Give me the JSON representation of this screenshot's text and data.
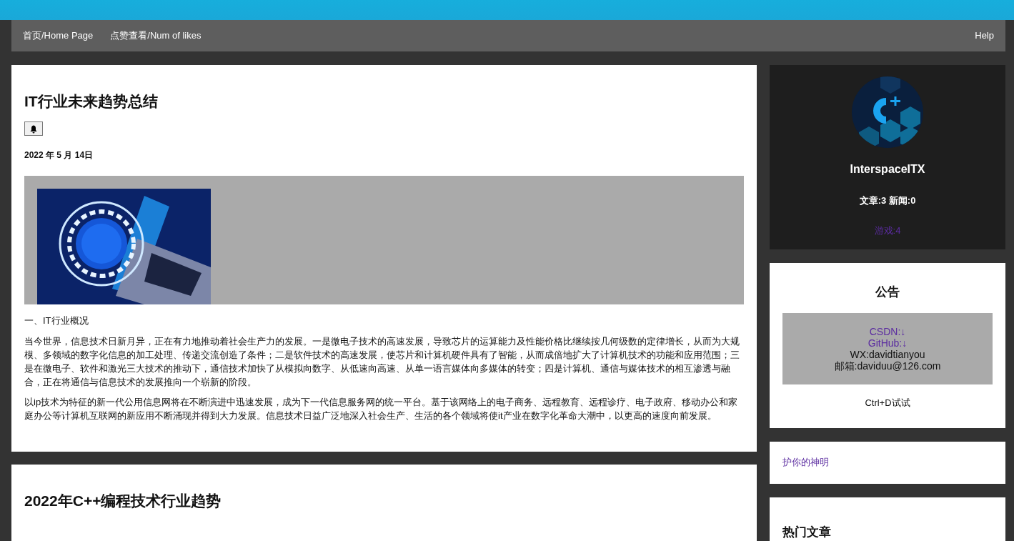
{
  "nav": {
    "items": [
      {
        "label": "首页/Home Page"
      },
      {
        "label": "点赞查看/Num of likes"
      }
    ],
    "help": "Help"
  },
  "articles": [
    {
      "title": "IT行业未来趋势总结",
      "bell": true,
      "date": "2022 年 5 月 14日",
      "image": {
        "kind": "picture"
      },
      "paragraphs": [
        "一、IT行业概况",
        "当今世界，信息技术日新月异，正在有力地推动着社会生产力的发展。一是微电子技术的高速发展，导致芯片的运算能力及性能价格比继续按几何级数的定律增长，从而为大规模、多领域的数字化信息的加工处理、传递交流创造了条件；二是软件技术的高速发展，使芯片和计算机硬件具有了智能，从而成倍地扩大了计算机技术的功能和应用范围；三是在微电子、软件和激光三大技术的推动下，通信技术加快了从模拟向数字、从低速向高速、从单一语言媒体向多媒体的转变；四是计算机、通信与媒体技术的相互渗透与融合，正在将通信与信息技术的发展推向一个崭新的阶段。",
        "以ip技术为特征的新一代公用信息网将在不断演进中迅速发展，成为下一代信息服务网的统一平台。基于该网络上的电子商务、远程教育、远程诊疗、电子政府、移动办公和家庭办公等计算机互联网的新应用不断涌现并得到大力发展。信息技术日益广泛地深入社会生产、生活的各个领域将使it产业在数字化革命大潮中，以更高的速度向前发展。"
      ]
    },
    {
      "title": "2022年C++编程技术行业趋势"
    }
  ],
  "sidebar": {
    "profile": {
      "avatar": {
        "kind": "picture"
      },
      "name": "InterspaceITX",
      "stats": "文章:3 新闻:0",
      "link": "游戏:4"
    },
    "notice": {
      "title": "公告",
      "lines": [
        {
          "kind": "link",
          "text": "CSDN:↓"
        },
        {
          "kind": "link",
          "text": "GitHub:↓"
        },
        {
          "kind": "text",
          "text": "WX:davidtianyou"
        },
        {
          "kind": "text",
          "text": "邮箱:daviduu@126.com"
        }
      ],
      "tip": "Ctrl+D试试"
    },
    "links": [
      {
        "text": "护你的神明"
      }
    ],
    "hot": {
      "title": "热门文章"
    }
  }
}
